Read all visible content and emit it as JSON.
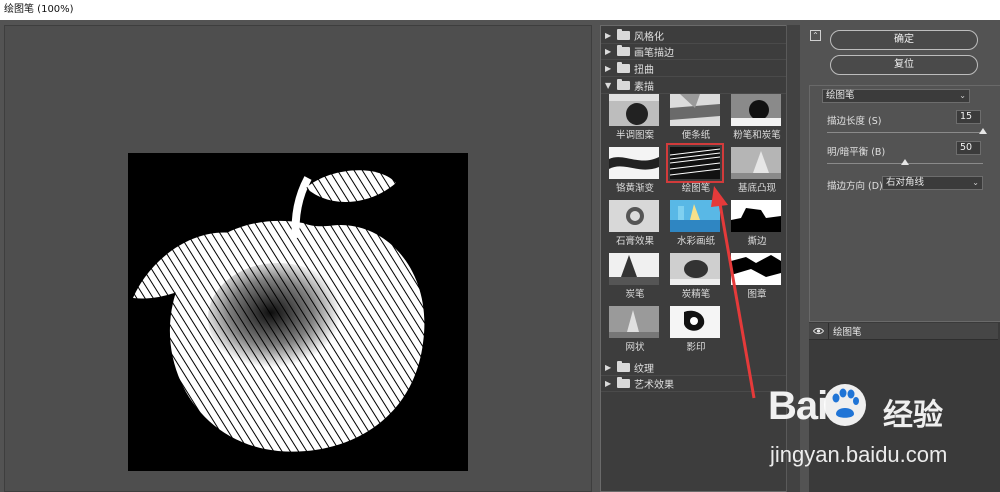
{
  "window": {
    "title": "绘图笔 (100%)"
  },
  "gallery": {
    "categories_top": [
      {
        "label": "风格化",
        "expanded": false
      },
      {
        "label": "画笔描边",
        "expanded": false
      },
      {
        "label": "扭曲",
        "expanded": false
      },
      {
        "label": "素描",
        "expanded": true
      }
    ],
    "filters": [
      {
        "label": "半调图案"
      },
      {
        "label": "便条纸"
      },
      {
        "label": "粉笔和炭笔"
      },
      {
        "label": "铬黄渐变"
      },
      {
        "label": "绘图笔",
        "selected": true
      },
      {
        "label": "基底凸现"
      },
      {
        "label": "石膏效果"
      },
      {
        "label": "水彩画纸"
      },
      {
        "label": "撕边"
      },
      {
        "label": "炭笔"
      },
      {
        "label": "炭精笔"
      },
      {
        "label": "图章"
      },
      {
        "label": "网状"
      },
      {
        "label": "影印"
      }
    ],
    "categories_bottom": [
      {
        "label": "纹理",
        "expanded": false
      },
      {
        "label": "艺术效果",
        "expanded": false
      }
    ]
  },
  "buttons": {
    "ok": "确定",
    "reset": "复位",
    "collapse": "⌃"
  },
  "settings": {
    "filter_select": "绘图笔",
    "stroke_length": {
      "label": "描边长度 (S)",
      "value": "15",
      "level": 1.0
    },
    "light_dark_balance": {
      "label": "明/暗平衡 (B)",
      "value": "50",
      "level": 0.5
    },
    "stroke_direction": {
      "label": "描边方向 (D):",
      "value": "右对角线"
    }
  },
  "layers": {
    "items": [
      {
        "name": "绘图笔",
        "visible": true
      }
    ]
  },
  "watermark": {
    "brand": "Bai",
    "brand_tail": "经验",
    "url": "jingyan.baidu.com"
  },
  "colors": {
    "highlight": "#d23b3b",
    "panel": "#535353",
    "dark": "#3d3d3d"
  }
}
